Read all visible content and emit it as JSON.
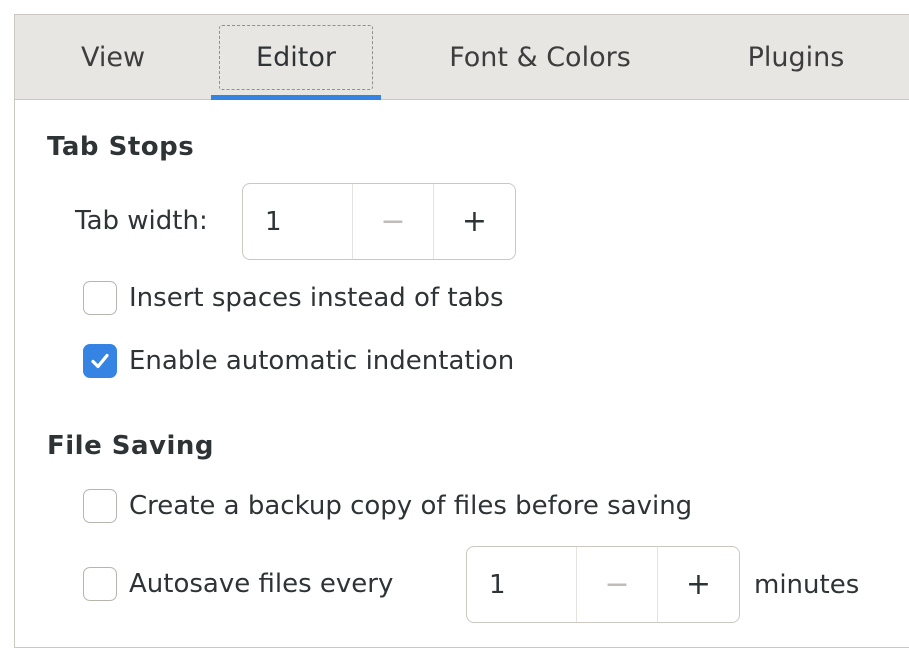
{
  "tabs": [
    {
      "label": "View",
      "active": false
    },
    {
      "label": "Editor",
      "active": true
    },
    {
      "label": "Font & Colors",
      "active": false
    },
    {
      "label": "Plugins",
      "active": false
    }
  ],
  "tab_stops": {
    "heading": "Tab Stops",
    "tab_width_label": "Tab width:",
    "tab_width_value": "1",
    "minus_glyph": "−",
    "plus_glyph": "+",
    "insert_spaces": {
      "label": "Insert spaces instead of tabs",
      "checked": false
    },
    "auto_indent": {
      "label": "Enable automatic indentation",
      "checked": true
    }
  },
  "file_saving": {
    "heading": "File Saving",
    "backup": {
      "label": "Create a backup copy of files before saving",
      "checked": false
    },
    "autosave": {
      "label": "Autosave files every",
      "checked": false
    },
    "autosave_value": "1",
    "minus_glyph": "−",
    "plus_glyph": "+",
    "autosave_unit": "minutes"
  },
  "colors": {
    "accent": "#3584e4",
    "tabbar_bg": "#e8e6e3",
    "border": "#cdc7c2"
  },
  "icons": {
    "check": "checkmark-icon"
  }
}
